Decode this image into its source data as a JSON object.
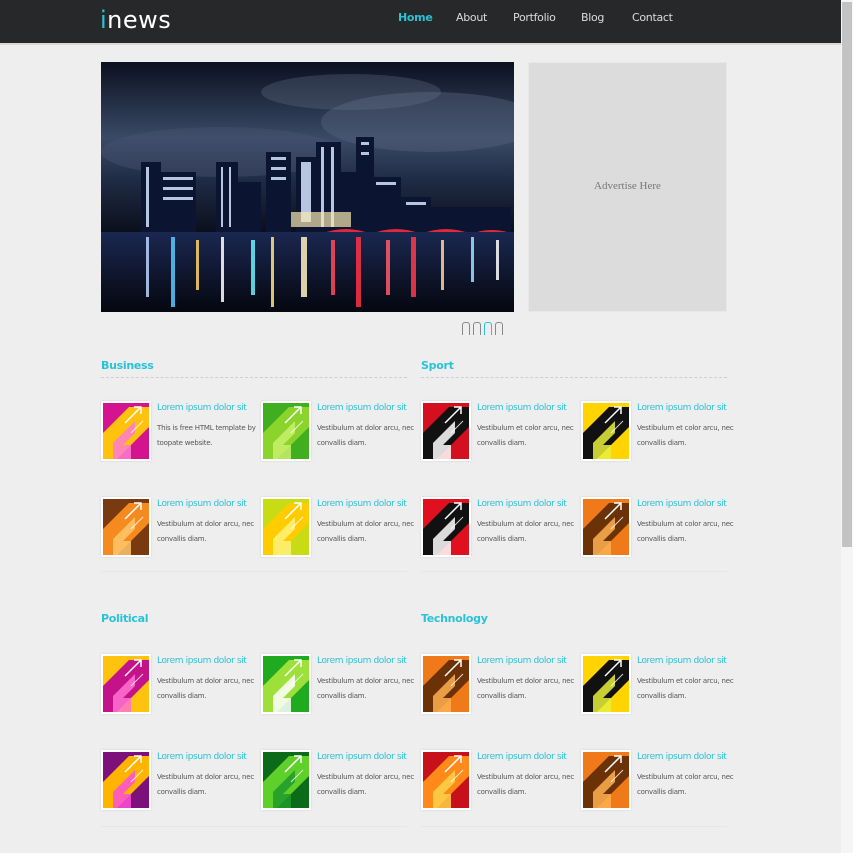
{
  "header": {
    "logo_i": "i",
    "logo_rest": "news",
    "nav": [
      "Home",
      "About",
      "Portfolio",
      "Blog",
      "Contact"
    ],
    "active_index": 0,
    "accent": "#29c3d7",
    "background": "#262829"
  },
  "hero": {
    "image": "night-city-skyline-waterfront",
    "slides": 3,
    "current_slide": 3
  },
  "ad": {
    "text": "Advertise Here"
  },
  "sections": [
    {
      "title": "Business",
      "items": [
        {
          "title": "Lorem ipsum dolor sit",
          "text": "This is free HTML template by toopate website.",
          "icon": "magenta-yellow-arrow-thumb"
        },
        {
          "title": "Lorem ipsum dolor sit",
          "text": "Vestibulum at dolor arcu, nec convallis diam.",
          "icon": "green-arrow-thumb"
        },
        {
          "title": "Lorem ipsum dolor sit",
          "text": "Vestibulum at dolor arcu, nec convallis diam.",
          "icon": "brown-orange-arrow-thumb"
        },
        {
          "title": "Lorem ipsum dolor sit",
          "text": "Vestibulum at dolor arcu, nec convallis diam.",
          "icon": "yellow-lime-arrow-thumb"
        }
      ]
    },
    {
      "title": "Sport",
      "items": [
        {
          "title": "Lorem ipsum dolor sit",
          "text": "Vestibulum et color arcu, nec convallis diam.",
          "icon": "red-arrow-thumb"
        },
        {
          "title": "Lorem ipsum dolor sit",
          "text": "Vestibulum et color arcu, nec convallis diam.",
          "icon": "yellow-black-arrow-thumb"
        },
        {
          "title": "Lorem ipsum dolor sit",
          "text": "Vestibulum at dolor arcu, nec convallis diam.",
          "icon": "red-black-arrow-thumb"
        },
        {
          "title": "Lorem ipsum dolor sit",
          "text": "Vestibulum at color arcu, nec convallis diam.",
          "icon": "orange-brown-arrow-thumb"
        }
      ]
    },
    {
      "title": "Political",
      "items": [
        {
          "title": "Lorem ipsum dolor sit",
          "text": "Vestibulum at dolor arcu, nec convallis diam.",
          "icon": "yellow-magenta-arrow-thumb"
        },
        {
          "title": "Lorem ipsum dolor sit",
          "text": "Vestibulum at dolor arcu, nec convallis diam.",
          "icon": "green-white-arrow-thumb"
        },
        {
          "title": "Lorem ipsum dolor sit",
          "text": "Vestibulum at dolor arcu, nec convallis diam.",
          "icon": "purple-yellow-arrow-thumb"
        },
        {
          "title": "Lorem ipsum dolor sit",
          "text": "Vestibulum at dolor arcu, nec convallis diam.",
          "icon": "darkgreen-arrow-thumb"
        }
      ]
    },
    {
      "title": "Technology",
      "items": [
        {
          "title": "Lorem ipsum dolor sit",
          "text": "Vestibulum et dolor arcu, nec convallis diam.",
          "icon": "orange-brown-arrow-thumb"
        },
        {
          "title": "Lorem ipsum dolor sit",
          "text": "Vestibulum et color arcu, nec convallis diam.",
          "icon": "yellow-black-arrow-thumb"
        },
        {
          "title": "Lorem ipsum dolor sit",
          "text": "Vestibulum at dolor arcu, nec convallis diam.",
          "icon": "red-orange-arrow-thumb"
        },
        {
          "title": "Lorem ipsum dolor sit",
          "text": "Vestibulum at color arcu, nec convallis diam.",
          "icon": "orange-brown-arrow-thumb"
        }
      ]
    }
  ]
}
